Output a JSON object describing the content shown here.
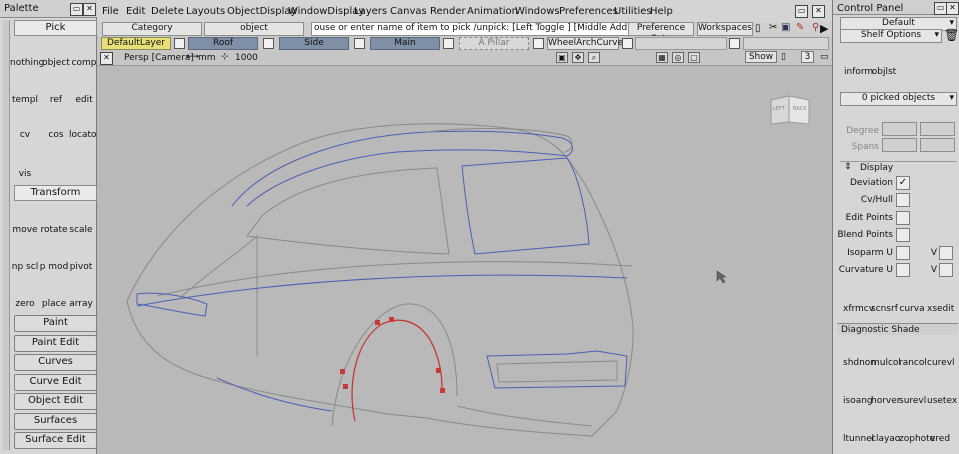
{
  "palette": {
    "title": "Palette",
    "pick_header": "Pick",
    "pick_tools": [
      {
        "label": "nothing",
        "icon": "nothing-icon"
      },
      {
        "label": "object",
        "icon": "object-pick-icon"
      },
      {
        "label": "comp",
        "icon": "component-pick-icon"
      },
      {
        "label": "templ",
        "icon": "template-pick-icon"
      },
      {
        "label": "ref",
        "icon": "reference-pick-icon"
      },
      {
        "label": "edit",
        "icon": "edit-pick-icon"
      },
      {
        "label": "cv",
        "icon": "cv-pick-icon"
      },
      {
        "label": "cos",
        "icon": "cos-pick-icon"
      },
      {
        "label": "locator",
        "icon": "locator-pick-icon"
      },
      {
        "label": "vis",
        "icon": "visible-pick-icon"
      }
    ],
    "transform_header": "Transform",
    "transform_tools": [
      {
        "label": "move",
        "icon": "move-icon"
      },
      {
        "label": "rotate",
        "icon": "rotate-icon"
      },
      {
        "label": "scale",
        "icon": "scale-icon"
      },
      {
        "label": "np scl",
        "icon": "nonproportional-scale-icon"
      },
      {
        "label": "p mod",
        "icon": "proportional-modify-icon"
      },
      {
        "label": "pivot",
        "icon": "pivot-icon"
      },
      {
        "label": "zero",
        "icon": "zero-transform-icon"
      },
      {
        "label": "place",
        "icon": "place-icon"
      },
      {
        "label": "array",
        "icon": "array-icon"
      }
    ],
    "section_buttons": [
      "Paint",
      "Paint Edit",
      "Curves",
      "Curve Edit",
      "Object Edit",
      "Surfaces",
      "Surface Edit"
    ]
  },
  "menubar": {
    "items": [
      "File",
      "Edit",
      "Delete",
      "Layouts",
      "ObjectDisplay",
      "WindowDisplay",
      "Layers",
      "Canvas",
      "Render",
      "Animation",
      "Windows",
      "Preferences",
      "Utilities",
      "Help"
    ]
  },
  "toolbar2": {
    "category_label": "Category",
    "object_label": "object",
    "prompt_text": "ouse or enter name of item to pick /unpick: [Left Toggle ] [Middle Add ] [Right Unpick ]",
    "preference_sets": "Preference Sets",
    "workspaces": "Workspaces"
  },
  "layers": {
    "items": [
      "DefaultLayer",
      "Roof",
      "Side",
      "Main",
      "A Pillar",
      "WheelArchCurves"
    ]
  },
  "viewport": {
    "camera_label": "Persp [Camera]",
    "units_label": "mm",
    "grid_value": "1000",
    "show_button": "Show",
    "view_number": "3",
    "cube_left": "LEFT",
    "cube_back": "BACK"
  },
  "control_panel": {
    "title": "Control Panel",
    "preset": "Default",
    "shelf_options": "Shelf Options",
    "shelf_items": [
      {
        "label": "inform",
        "icon": "info-icon"
      },
      {
        "label": "objlst",
        "icon": "object-list-icon"
      }
    ],
    "picked_objects": "0 picked objects",
    "degree_label": "Degree",
    "spans_label": "Spans",
    "display_header": "Display",
    "display_options": [
      {
        "label": "Deviation",
        "checked": true
      },
      {
        "label": "Cv/Hull",
        "checked": false
      },
      {
        "label": "Edit Points",
        "checked": false
      },
      {
        "label": "Blend Points",
        "checked": false
      },
      {
        "label": "Isoparm U",
        "checked": false
      },
      {
        "label": "Curvature U",
        "checked": false
      }
    ],
    "v_label": "V",
    "tool_shelf": [
      {
        "label": "xfrmcv",
        "icon": "transform-cv-icon"
      },
      {
        "label": "scnsrf",
        "icon": "scan-surface-icon"
      },
      {
        "label": "curva",
        "icon": "curvature-icon"
      },
      {
        "label": "xsedit",
        "icon": "cross-section-edit-icon"
      }
    ],
    "diagnostic_header": "Diagnostic Shade",
    "diagnostic_items": [
      {
        "label": "shdnon",
        "icon": "shade-off-icon"
      },
      {
        "label": "mulcol",
        "icon": "multi-color-icon"
      },
      {
        "label": "rancol",
        "icon": "random-color-icon"
      },
      {
        "label": "curevl",
        "icon": "curvature-eval-icon"
      },
      {
        "label": "isoang",
        "icon": "isoangle-icon"
      },
      {
        "label": "horver",
        "icon": "horizontal-vertical-icon"
      },
      {
        "label": "surevl",
        "icon": "surface-eval-icon"
      },
      {
        "label": "usetex",
        "icon": "use-texture-icon"
      },
      {
        "label": "ltunnel",
        "icon": "light-tunnel-icon"
      },
      {
        "label": "clayao",
        "icon": "clay-ao-icon"
      },
      {
        "label": "zophote",
        "icon": "zebra-photo-icon"
      },
      {
        "label": "vred",
        "icon": "vred-icon"
      }
    ]
  },
  "colors": {
    "ui_gray": "#d6d6d6",
    "viewport_bg": "#b9b9b9",
    "layer_default": "#e7e079",
    "layer_other": "#7e8fa6",
    "wire_gray": "#8a8a8a",
    "wire_blue": "#4c5fb3",
    "curve_red": "#c23a3a"
  }
}
